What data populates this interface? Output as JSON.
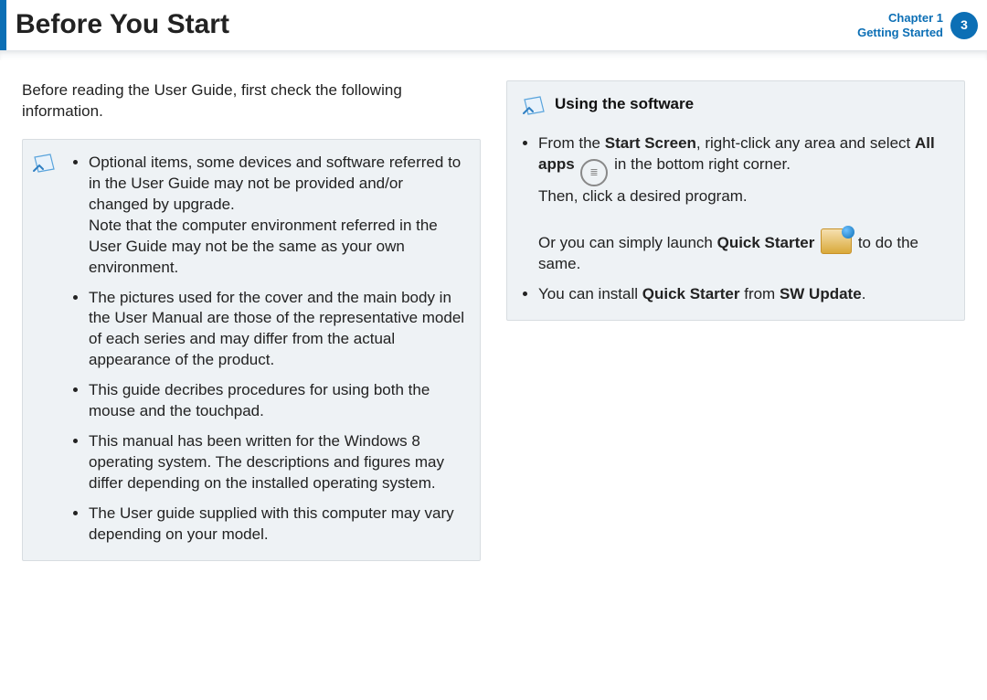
{
  "header": {
    "title": "Before You Start",
    "chapter_line1": "Chapter 1",
    "chapter_line2": "Getting Started",
    "page_number": "3"
  },
  "left": {
    "intro": "Before reading the User Guide, first check the following information.",
    "notes": [
      {
        "text_a": "Optional items, some devices and software referred to in the User Guide may not be provided and/or changed by upgrade.",
        "text_b": "Note that the computer environment referred in the User Guide may not be the same as your own environment."
      },
      {
        "text": "The pictures used for the cover and the main body in the User Manual are those of the representative model of each series and may differ from the actual appearance of the product."
      },
      {
        "text": "This guide decribes procedures for using both the mouse and the touchpad."
      },
      {
        "text": "This manual has been written for the Windows 8 operating system. The descriptions and figures may differ depending on the installed operating system."
      },
      {
        "text": "The User guide supplied with this computer may vary depending on your model."
      }
    ]
  },
  "right": {
    "title": "Using the software",
    "item1": {
      "pre": "From the ",
      "b1": "Start Screen",
      "mid1": ", right-click any area and select ",
      "b2": "All apps",
      "mid2": " in the bottom right corner.",
      "line2": "Then, click a desired program.",
      "line3_pre": "Or you can simply launch ",
      "line3_b": "Quick Starter",
      "line3_post": " to do the same."
    },
    "item2": {
      "pre": "You can install ",
      "b1": "Quick Starter",
      "mid": " from ",
      "b2": "SW Update",
      "post": "."
    }
  },
  "icons": {
    "note": "note-icon",
    "all_apps": "all-apps-icon",
    "quick_starter": "quick-starter-icon"
  }
}
